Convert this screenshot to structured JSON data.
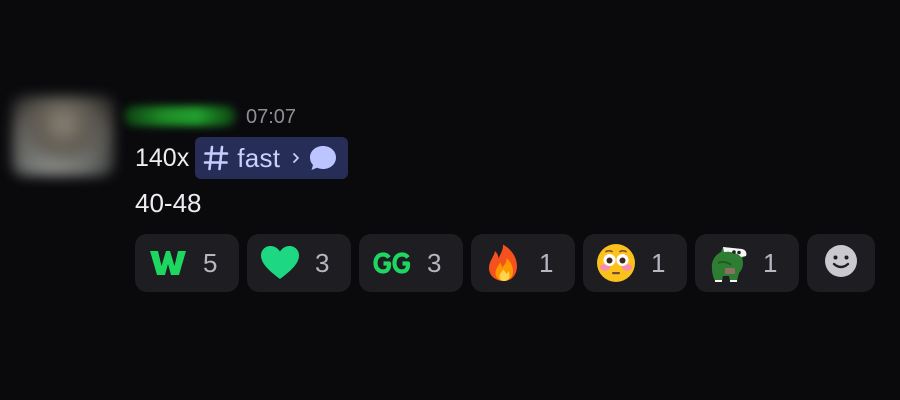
{
  "message": {
    "timestamp": "07:07",
    "content_prefix": "140x",
    "channel_mention": {
      "name": "fast"
    },
    "content_line2": "40-48"
  },
  "reactions": [
    {
      "icon": "w-letter-emoji",
      "count": "5"
    },
    {
      "icon": "green-heart-emoji",
      "count": "3"
    },
    {
      "icon": "gg-text-emoji",
      "count": "3"
    },
    {
      "icon": "fire-emoji",
      "count": "1"
    },
    {
      "icon": "flushed-face-emoji",
      "count": "1"
    },
    {
      "icon": "frog-custom-emoji",
      "count": "1"
    }
  ],
  "colors": {
    "background": "#0a0a0d",
    "mention_bg": "#262d56",
    "mention_text": "#c9d0ff",
    "reaction_bg": "#1d1d22",
    "accent_green": "#1ed760"
  }
}
